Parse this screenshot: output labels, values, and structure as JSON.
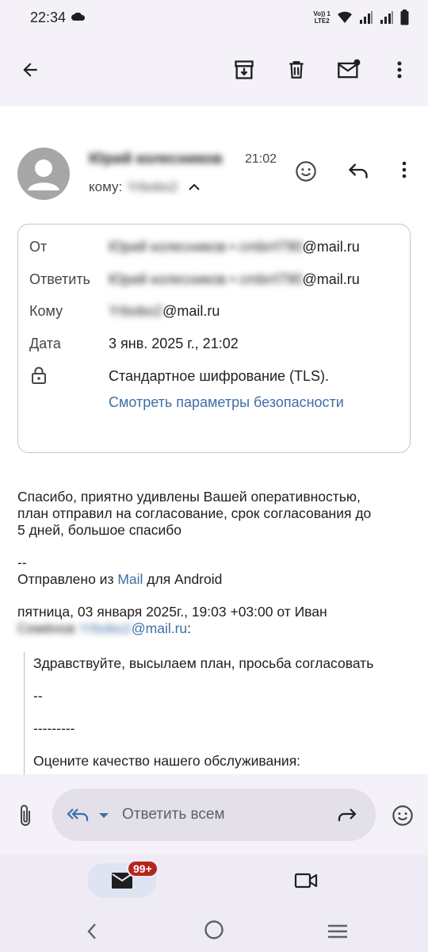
{
  "status_bar": {
    "time": "22:34",
    "network_label_top": "Vo)) 1",
    "network_label_bottom": "LTE2",
    "icons": [
      "cloud-icon",
      "wifi-icon",
      "signal-icon",
      "signal-icon-2",
      "battery-icon"
    ]
  },
  "toolbar": {
    "icons": [
      "back-arrow-icon",
      "archive-icon",
      "trash-icon",
      "mark-unread-icon",
      "more-vert-icon"
    ]
  },
  "message": {
    "sender_name": "Юрий колесников",
    "time": "21:02",
    "to_label": "кому:",
    "to_value": "Yrbobo2"
  },
  "details": {
    "from_label": "От",
    "from_value_blurred": "Юрий колесников • cmbrrl790",
    "from_value_domain": "@mail.ru",
    "reply_label": "Ответить",
    "reply_value_blurred": "Юрий колесников • cmbrrl790",
    "reply_value_domain": "@mail.ru",
    "to_label": "Кому",
    "to_value_blurred": "Yrbobo2",
    "to_value_domain": "@mail.ru",
    "date_label": "Дата",
    "date_value": "3 янв. 2025 г., 21:02",
    "encryption_value": "Стандартное шифрование (TLS).",
    "security_link": "Смотреть параметры безопасности"
  },
  "body": {
    "line1": "Спасибо, приятно удивлены Вашей оперативностью,",
    "line2": "план отправил на согласование, срок согласования до",
    "line3": "5 дней, большое спасибо",
    "separator": "--",
    "sent_from_prefix": "Отправлено из ",
    "sent_from_link": "Mail",
    "sent_from_suffix": " для Android",
    "quote_header_line1": "пятница, 03 января 2025г., 19:03 +03:00 от Иван",
    "quote_header_blurred_name": "Семёнов",
    "quote_header_blurred_email": "Yrbobo2",
    "quote_header_domain": "@mail.ru",
    "quote_header_colon": ":"
  },
  "quote": {
    "line1": "Здравствуйте, высылаем план, просьба согласовать",
    "line2": "--",
    "line3": "---------",
    "line4": "Оцените качество нашего обслуживания:"
  },
  "compose": {
    "placeholder": "Ответить всем"
  },
  "bottom_nav": {
    "badge": "99+"
  },
  "colors": {
    "link": "#3f6fa6",
    "badge": "#b3261e",
    "background": "#f4f1f8"
  }
}
